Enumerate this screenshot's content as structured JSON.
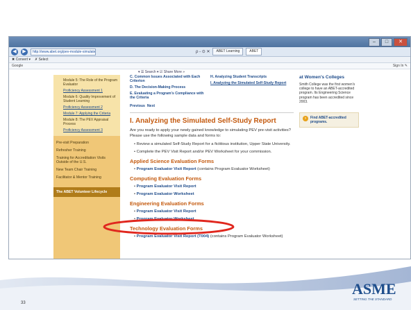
{
  "browser": {
    "url": "http://www.abet.org/pev-module-simulated-study-report",
    "controls": "ρ - ⊙ ✕",
    "tabs": [
      {
        "label": "ABET Learning",
        "active": false
      },
      {
        "label": "ABET",
        "active": true
      }
    ],
    "menu": [
      "✖ Convert ▾",
      "✗ Select"
    ],
    "favorites_left": "Google",
    "favorites_right": "Sign In ✎",
    "toolbar": "▾ ☰ Search ▾  ☑ Share  More »"
  },
  "sidebar": {
    "sub_items": [
      {
        "label": "Module 5: The Role of the Program Evaluator",
        "link": false
      },
      {
        "label": "Proficiency Assessment 1",
        "link": true
      },
      {
        "label": "Module 6: Quality Improvement of Student Learning",
        "link": false
      },
      {
        "label": "Proficiency Assessment 2",
        "link": true
      },
      {
        "label": "Module 7: Applying the Criteria",
        "link": true
      },
      {
        "label": "Module 8: The PEV Appraisal Process",
        "link": false
      },
      {
        "label": "Proficiency Assessment 3",
        "link": true
      }
    ],
    "main_items": [
      "Pre-visit Preparation",
      "Refresher Training",
      "Training for Accreditation Visits Outside of the U.S.",
      "New Team Chair Training",
      "Facilitator & Mentor Training"
    ],
    "volunteer_box": "The ABET Volunteer Lifecycle"
  },
  "toc": {
    "left": [
      "C. Common Issues Associated with Each Criterion",
      "D. The Decision-Making Process",
      "E. Evaluating a Program's Compliance with the Criteria"
    ],
    "right": [
      "H. Analyzing Student Transcripts",
      "I. Analyzing the Simulated Self-Study Report"
    ]
  },
  "pagination": {
    "previous": "Previous",
    "next": "Next"
  },
  "main": {
    "title": "I. Analyzing the Simulated Self-Study Report",
    "intro": "Are you ready to apply your newly gained knowledge to simulating PEV pre-visit activities? Please use the following sample data and forms to:",
    "bullets": [
      "Review a simulated Self-Study Report for a fictitious institution, Upper State University.",
      "Complete the PEV Visit Report and/or PEV Worksheet for your commission."
    ],
    "sections": [
      {
        "heading": "Applied Science Evaluation Forms",
        "items": [
          {
            "link": "Program Evaluator Visit Report",
            "note": "(contains Program Evaluator Worksheet)"
          }
        ]
      },
      {
        "heading": "Computing Evaluation Forms",
        "items": [
          {
            "link": "Program Evaluator Visit Report",
            "note": ""
          },
          {
            "link": "Program Evaluator Worksheet",
            "note": ""
          }
        ]
      },
      {
        "heading": "Engineering Evaluation Forms",
        "items": [
          {
            "link": "Program Evaluator Visit Report",
            "note": ""
          },
          {
            "link": "Program Evaluator Worksheet",
            "note": ""
          }
        ]
      },
      {
        "heading": "Technology Evaluation Forms",
        "items": [
          {
            "link": "Program Evaluator Visit Report (T004)",
            "note": "(contains Program Evaluator Worksheet)"
          }
        ]
      }
    ]
  },
  "right_panel": {
    "title": "at Women's Colleges",
    "text": "Smith College was the first women's college to have an ABET-accredited program. Its Engineering Science program has been accredited since 2003.",
    "find_link": "Find ABET-accredited programs."
  },
  "slide": {
    "number": "33",
    "logo": "ASME",
    "tagline": "SETTING THE STANDARD",
    "colors": {
      "accent_orange": "#c45a0f",
      "link_blue": "#1e4b8a",
      "sidebar": "#f0c777",
      "highlight_circle": "#e0271e"
    }
  }
}
